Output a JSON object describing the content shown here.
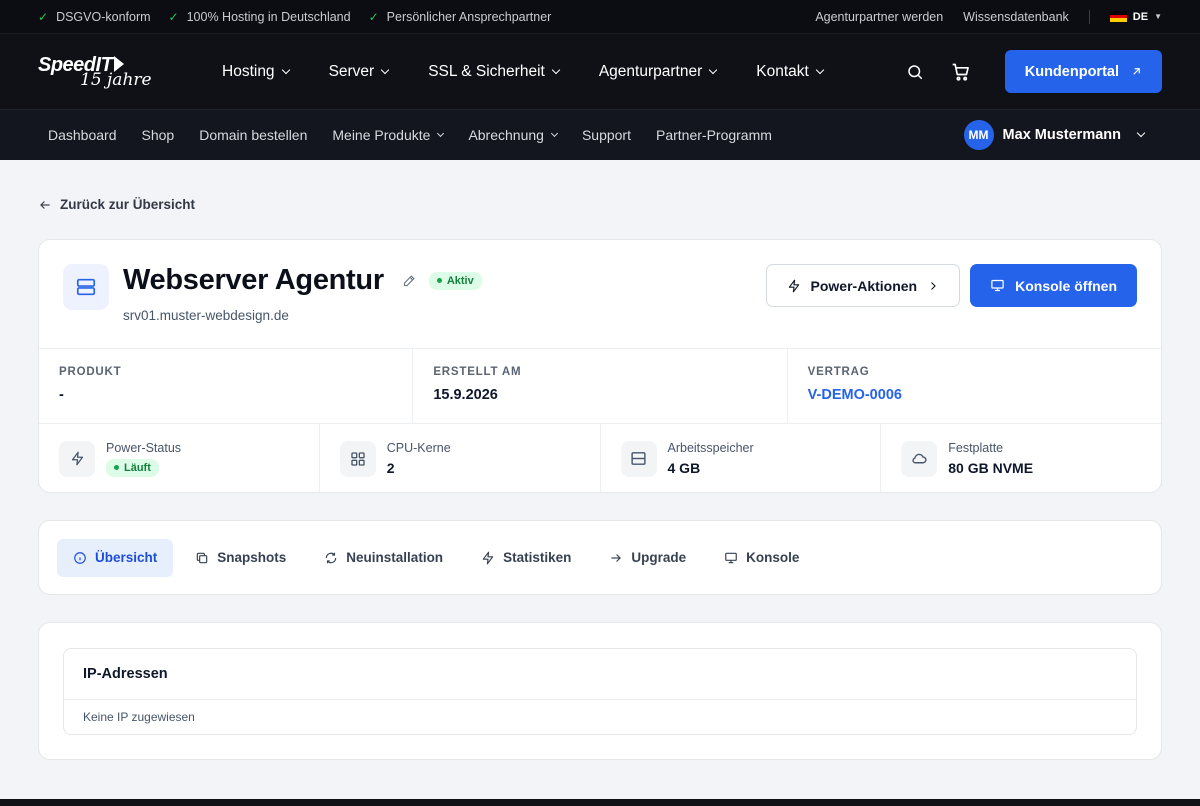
{
  "topbar": {
    "usps": [
      "DSGVO-konform",
      "100% Hosting in Deutschland",
      "Persönlicher Ansprechpartner"
    ],
    "links": [
      "Agenturpartner werden",
      "Wissensdatenbank"
    ],
    "language": "DE"
  },
  "logo": {
    "line1": "SpeedIT",
    "line2": "15 jahre"
  },
  "mainnav": {
    "items": [
      "Hosting",
      "Server",
      "SSL & Sicherheit",
      "Agenturpartner",
      "Kontakt"
    ],
    "cta": "Kundenportal"
  },
  "subnav": {
    "items": [
      {
        "label": "Dashboard",
        "dropdown": false
      },
      {
        "label": "Shop",
        "dropdown": false
      },
      {
        "label": "Domain bestellen",
        "dropdown": false
      },
      {
        "label": "Meine Produkte",
        "dropdown": true
      },
      {
        "label": "Abrechnung",
        "dropdown": true
      },
      {
        "label": "Support",
        "dropdown": false
      },
      {
        "label": "Partner-Programm",
        "dropdown": false
      }
    ],
    "user": {
      "initials": "MM",
      "name": "Max Mustermann"
    }
  },
  "back_link": "Zurück zur Übersicht",
  "server": {
    "name": "Webserver Agentur",
    "status_badge": "Aktiv",
    "hostname": "srv01.muster-webdesign.de",
    "actions": {
      "power": "Power-Aktionen",
      "console": "Konsole öffnen"
    },
    "meta": [
      {
        "label": "PRODUKT",
        "value": "-"
      },
      {
        "label": "ERSTELLT AM",
        "value": "15.9.2026"
      },
      {
        "label": "VERTRAG",
        "value": "V-DEMO-0006"
      }
    ],
    "stats": {
      "power": {
        "label": "Power-Status",
        "value": "Läuft"
      },
      "cpu": {
        "label": "CPU-Kerne",
        "value": "2"
      },
      "ram": {
        "label": "Arbeitsspeicher",
        "value": "4 GB"
      },
      "disk": {
        "label": "Festplatte",
        "value": "80 GB NVME"
      }
    }
  },
  "tabs": [
    "Übersicht",
    "Snapshots",
    "Neuinstallation",
    "Statistiken",
    "Upgrade",
    "Konsole"
  ],
  "ip": {
    "title": "IP-Adressen",
    "empty": "Keine IP zugewiesen"
  },
  "colors": {
    "accent": "#2563eb",
    "success": "#16a34a",
    "dark": "#0f1117"
  }
}
